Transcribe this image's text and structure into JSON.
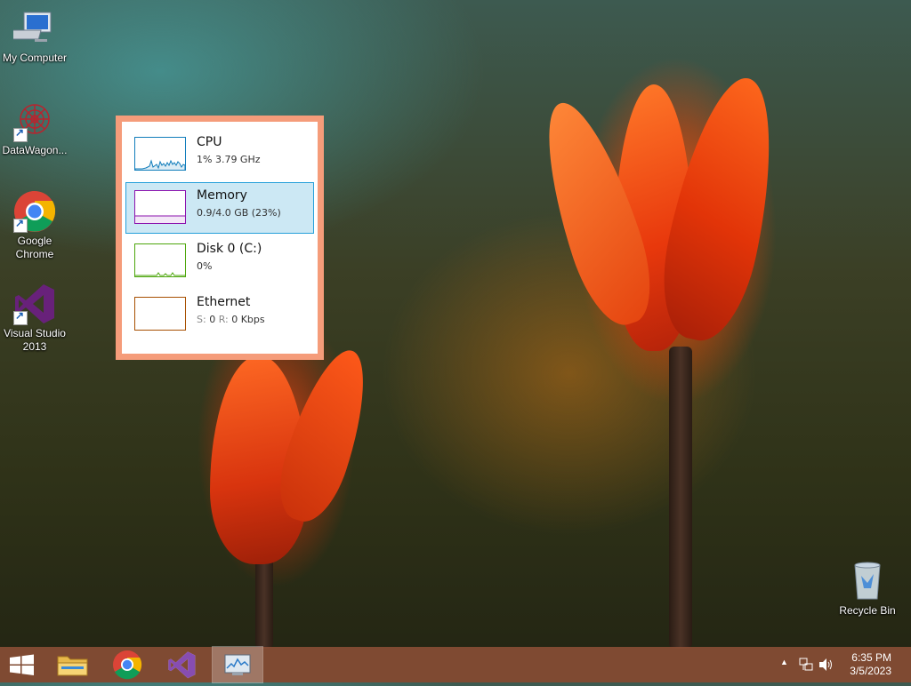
{
  "desktop": {
    "icons": [
      {
        "label": "My Computer"
      },
      {
        "label": "DataWagon..."
      },
      {
        "label": "Google Chrome"
      },
      {
        "label": "Visual Studio 2013"
      },
      {
        "label": "Recycle Bin"
      }
    ]
  },
  "task_manager": {
    "items": [
      {
        "title": "CPU",
        "detail": "1%  3.79 GHz",
        "color": "#117dbb"
      },
      {
        "title": "Memory",
        "detail": "0.9/4.0 GB (23%)",
        "color": "#8b12ae"
      },
      {
        "title": "Disk 0 (C:)",
        "detail": "0%",
        "color": "#4da60c"
      },
      {
        "title": "Ethernet",
        "detail_s_label": "S:",
        "detail_s_value": "0",
        "detail_r_label": "R:",
        "detail_r_value": "0 Kbps",
        "color": "#a74f01"
      }
    ],
    "selected": "Memory"
  },
  "taskbar": {
    "pinned": [
      "start-button",
      "file-explorer",
      "google-chrome",
      "visual-studio",
      "task-manager"
    ],
    "active": "task-manager"
  },
  "tray": {
    "time": "6:35 PM",
    "date": "3/5/2023"
  },
  "colors": {
    "panel_border": "#f59c7a",
    "selection_bg": "#cce8f4",
    "selection_border": "#26a0da",
    "taskbar": "#8c5037"
  }
}
